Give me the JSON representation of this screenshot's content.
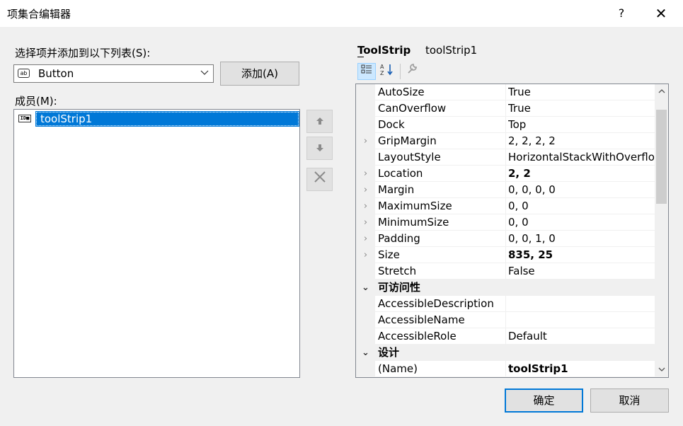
{
  "window": {
    "title": "项集合编辑器",
    "help_label": "?",
    "close_label": "✕"
  },
  "left": {
    "select_label": "选择项并添加到以下列表(S):",
    "combo_icon": "ab",
    "combo_value": "Button",
    "add_button": "添加(A)",
    "members_label": "成员(M):",
    "members": [
      {
        "icon": "ID■",
        "label": "toolStrip1",
        "selected": true
      }
    ],
    "move_up_icon": "🡅",
    "move_down_icon": "🡇",
    "remove_icon": "✕"
  },
  "properties": {
    "type_name": "ToolStrip",
    "object_name": "toolStrip1",
    "toolbar": {
      "categorized_icon": "☷",
      "alphabetical_icon": "A↓",
      "property_pages_icon": "🔧"
    },
    "rows": [
      {
        "expander": "",
        "name": "AutoSize",
        "value": "True",
        "bold": false,
        "category": false
      },
      {
        "expander": "",
        "name": "CanOverflow",
        "value": "True",
        "bold": false,
        "category": false
      },
      {
        "expander": "",
        "name": "Dock",
        "value": "Top",
        "bold": false,
        "category": false
      },
      {
        "expander": "›",
        "name": "GripMargin",
        "value": "2, 2, 2, 2",
        "bold": false,
        "category": false
      },
      {
        "expander": "",
        "name": "LayoutStyle",
        "value": "HorizontalStackWithOverflow",
        "bold": false,
        "category": false
      },
      {
        "expander": "›",
        "name": "Location",
        "value": "2, 2",
        "bold": true,
        "category": false
      },
      {
        "expander": "›",
        "name": "Margin",
        "value": "0, 0, 0, 0",
        "bold": false,
        "category": false
      },
      {
        "expander": "›",
        "name": "MaximumSize",
        "value": "0, 0",
        "bold": false,
        "category": false
      },
      {
        "expander": "›",
        "name": "MinimumSize",
        "value": "0, 0",
        "bold": false,
        "category": false
      },
      {
        "expander": "›",
        "name": "Padding",
        "value": "0, 0, 1, 0",
        "bold": false,
        "category": false
      },
      {
        "expander": "›",
        "name": "Size",
        "value": "835, 25",
        "bold": true,
        "category": false
      },
      {
        "expander": "",
        "name": "Stretch",
        "value": "False",
        "bold": false,
        "category": false
      },
      {
        "expander": "⌄",
        "name": "可访问性",
        "value": "",
        "bold": false,
        "category": true
      },
      {
        "expander": "",
        "name": "AccessibleDescription",
        "value": "",
        "bold": false,
        "category": false
      },
      {
        "expander": "",
        "name": "AccessibleName",
        "value": "",
        "bold": false,
        "category": false
      },
      {
        "expander": "",
        "name": "AccessibleRole",
        "value": "Default",
        "bold": false,
        "category": false
      },
      {
        "expander": "⌄",
        "name": "设计",
        "value": "",
        "bold": false,
        "category": true
      },
      {
        "expander": "",
        "name": "(Name)",
        "value": "toolStrip1",
        "bold": true,
        "category": false
      }
    ],
    "scroll_up": "^",
    "scroll_down": "v"
  },
  "footer": {
    "ok_button": "确定",
    "cancel_button": "取消"
  },
  "colors": {
    "selection": "#0078d7",
    "dialog_bg": "#f0f0f0"
  }
}
